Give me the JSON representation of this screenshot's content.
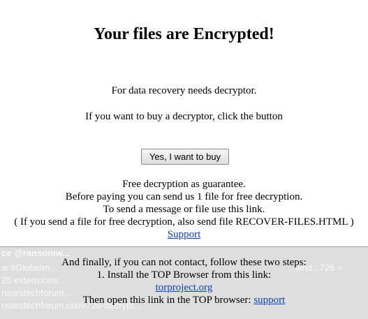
{
  "title": "Your files are Encrypted!",
  "intro": {
    "line1": "For data recovery needs decryptor.",
    "line2": "If you want to buy a decryptor, click the button"
  },
  "buy_button_label": "Yes, I want to buy",
  "guarantee": {
    "line1": "Free decryption as guarantee.",
    "line2": "Before paying you can send us 1 file for free decryption.",
    "line3": "To send a message or file use this link.",
    "line4": "( If you send a file for free decryption, also send file RECOVER-FILES.HTML )",
    "support_link": "Support"
  },
  "background_overlay": {
    "line1": "ce @ransomw...",
    "line2": "w #GlobeIm...",
    "line3": "25 extensions:",
    "line4": "nsorstechforum...",
    "line5": "nsorstechforum.com/726-decrypt...",
    "line6": "...lfind ..726 +"
  },
  "steps": {
    "intro": "And finally, if you can not contact, follow these two steps:",
    "step1": "1. Install the TOP Browser from this link:",
    "tor_link": "torproject.org",
    "step2_prefix": "Then open this link in the TOP browser:",
    "support_link": "support"
  },
  "colors": {
    "link": "#0b3fbf",
    "panel_background": "#dedede"
  }
}
